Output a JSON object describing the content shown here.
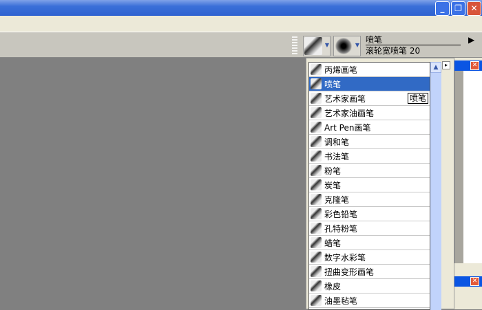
{
  "window": {
    "minimize": "_",
    "restore": "❐",
    "close": "✕"
  },
  "propbar": {
    "brush_category": "喷笔",
    "variant": "滚轮宽喷笔 20",
    "flyout": "▶"
  },
  "brush_list": {
    "selected": "喷笔",
    "tooltip": "喷笔",
    "items": [
      "丙烯画笔",
      "喷笔",
      "艺术家画笔",
      "艺术家油画笔",
      "Art Pen画笔",
      "调和笔",
      "书法笔",
      "粉笔",
      "炭笔",
      "克隆笔",
      "彩色铅笔",
      "孔特粉笔",
      "蜡笔",
      "数字水彩笔",
      "扭曲变形画笔",
      "橡皮",
      "油墨毡笔"
    ]
  },
  "scrollbar": {
    "up": "▲"
  },
  "panel": {
    "close": "✕",
    "menu": "▸"
  }
}
